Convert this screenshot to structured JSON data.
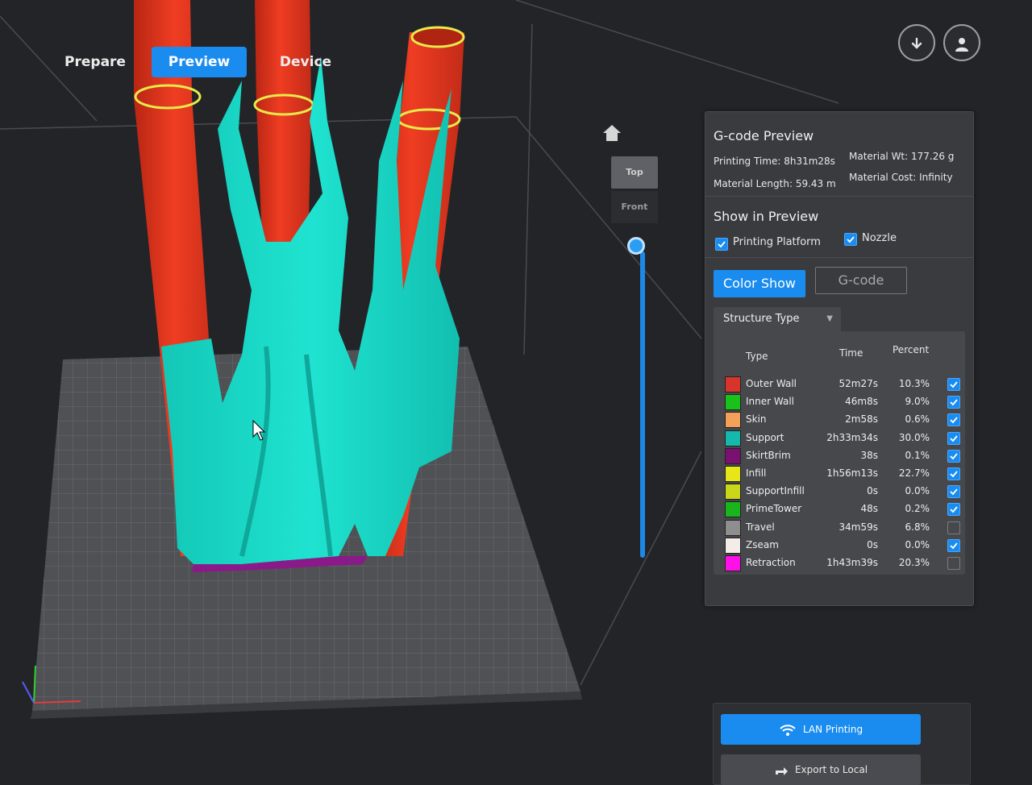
{
  "nav": {
    "prepare": "Prepare",
    "preview": "Preview",
    "device": "Device"
  },
  "toolbar": {
    "download_icon": "download-icon",
    "account_icon": "account-icon"
  },
  "view": {
    "home_icon": "home-icon",
    "top": "Top",
    "front": "Front",
    "layer_level": 1.0
  },
  "gcode_preview": {
    "title": "G-code Preview",
    "printing_time": "Printing Time: 8h31m28s",
    "material_weight": "Material Wt: 177.26 g",
    "material_length": "Material Length: 59.43 m",
    "material_cost": "Material Cost: Infinity"
  },
  "show_in_preview": {
    "title": "Show in Preview",
    "printing_platform": {
      "label": "Printing Platform",
      "checked": true
    },
    "nozzle": {
      "label": "Nozzle",
      "checked": true
    }
  },
  "mode_buttons": {
    "color_show": "Color Show",
    "gcode": "G-code"
  },
  "structure": {
    "dropdown_label": "Structure Type",
    "headers": {
      "type": "Type",
      "time": "Time",
      "percent": "Percent"
    },
    "rows": [
      {
        "name": "Outer Wall",
        "time": "52m27s",
        "percent": "10.3%",
        "color": "#d9342b",
        "checked": true
      },
      {
        "name": "Inner Wall",
        "time": "46m8s",
        "percent": "9.0%",
        "color": "#18c21a",
        "checked": true
      },
      {
        "name": "Skin",
        "time": "2m58s",
        "percent": "0.6%",
        "color": "#f2a05a",
        "checked": true
      },
      {
        "name": "Support",
        "time": "2h33m34s",
        "percent": "30.0%",
        "color": "#14b8ad",
        "checked": true
      },
      {
        "name": "SkirtBrim",
        "time": "38s",
        "percent": "0.1%",
        "color": "#7a1070",
        "checked": true
      },
      {
        "name": "Infill",
        "time": "1h56m13s",
        "percent": "22.7%",
        "color": "#e6e619",
        "checked": true
      },
      {
        "name": "SupportInfill",
        "time": "0s",
        "percent": "0.0%",
        "color": "#c9d61a",
        "checked": true
      },
      {
        "name": "PrimeTower",
        "time": "48s",
        "percent": "0.2%",
        "color": "#18b51c",
        "checked": true
      },
      {
        "name": "Travel",
        "time": "34m59s",
        "percent": "6.8%",
        "color": "#8e8e8e",
        "checked": false
      },
      {
        "name": "Zseam",
        "time": "0s",
        "percent": "0.0%",
        "color": "#f4ece6",
        "checked": true
      },
      {
        "name": "Retraction",
        "time": "1h43m39s",
        "percent": "20.3%",
        "color": "#ff10e8",
        "checked": false
      }
    ]
  },
  "actions": {
    "lan_printing": "LAN Printing",
    "export_local": "Export to Local",
    "wifi_icon": "wifi-icon",
    "export_icon": "export-icon"
  }
}
